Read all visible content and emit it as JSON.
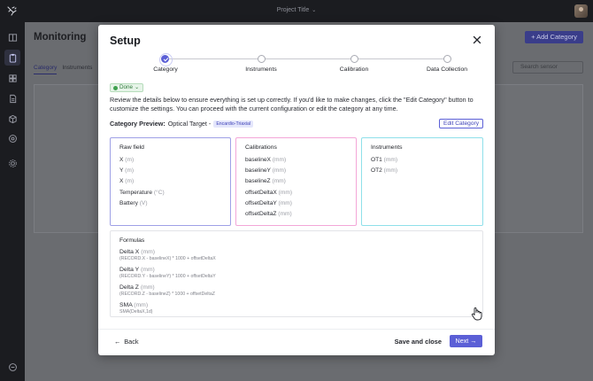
{
  "topbar": {
    "project_title": "Project Title"
  },
  "page": {
    "title": "Monitoring",
    "add_button": "+ Add Category",
    "tabs": [
      "Category",
      "Instruments"
    ],
    "search_placeholder": "Search sensor"
  },
  "modal": {
    "title": "Setup",
    "steps": [
      {
        "label": "Category",
        "state": "done"
      },
      {
        "label": "Instruments",
        "state": "pending"
      },
      {
        "label": "Calibration",
        "state": "pending"
      },
      {
        "label": "Data Collection",
        "state": "pending"
      }
    ],
    "status_badge": "Done",
    "review_text": "Review the details below to ensure everything is set up correctly. If you'd like to make changes, click the \"Edit Category\" button to customize the settings. You can proceed with the current configuration or edit the category at any time.",
    "preview_label": "Category Preview:",
    "preview_value": "Optical Target -",
    "preview_tag": "Encardio-Triaxial",
    "edit_button": "Edit Category",
    "raw_field": {
      "title": "Raw field",
      "items": [
        {
          "name": "X",
          "unit": "(m)"
        },
        {
          "name": "Y",
          "unit": "(m)"
        },
        {
          "name": "X",
          "unit": "(m)"
        },
        {
          "name": "Temperature",
          "unit": "(°C)"
        },
        {
          "name": "Battery",
          "unit": "(V)"
        }
      ]
    },
    "calibrations": {
      "title": "Calibrations",
      "items": [
        {
          "name": "baselineX",
          "unit": "(mm)"
        },
        {
          "name": "baselineY",
          "unit": "(mm)"
        },
        {
          "name": "baselineZ",
          "unit": "(mm)"
        },
        {
          "name": "offsetDeltaX",
          "unit": "(mm)"
        },
        {
          "name": "offsetDeltaY",
          "unit": "(mm)"
        },
        {
          "name": "offsetDeltaZ",
          "unit": "(mm)"
        }
      ]
    },
    "instruments": {
      "title": "Instruments",
      "items": [
        {
          "name": "OT1",
          "unit": "(mm)"
        },
        {
          "name": "OT2",
          "unit": "(mm)"
        }
      ]
    },
    "formulas": {
      "title": "Formulas",
      "items": [
        {
          "name": "Delta X",
          "unit": "(mm)",
          "expr": "(RECORD.X - baselineX) * 1000 + offsetDeltaX"
        },
        {
          "name": "Delta Y",
          "unit": "(mm)",
          "expr": "(RECORD.Y - baselineY) * 1000 + offsetDeltaY"
        },
        {
          "name": "Delta Z",
          "unit": "(mm)",
          "expr": "(RECORD.Z - baselineZ) * 1000 + offsetDeltaZ"
        },
        {
          "name": "SMA",
          "unit": "(mm)",
          "expr": "SMA(DeltaX,1d)"
        }
      ]
    },
    "footer": {
      "back": "Back",
      "save_close": "Save and close",
      "next": "Next"
    }
  },
  "colors": {
    "accent": "#5b5fd6",
    "raw_border": "#9ea0e6",
    "calib_border": "#f3a6d8",
    "instr_border": "#8fe0ea"
  }
}
